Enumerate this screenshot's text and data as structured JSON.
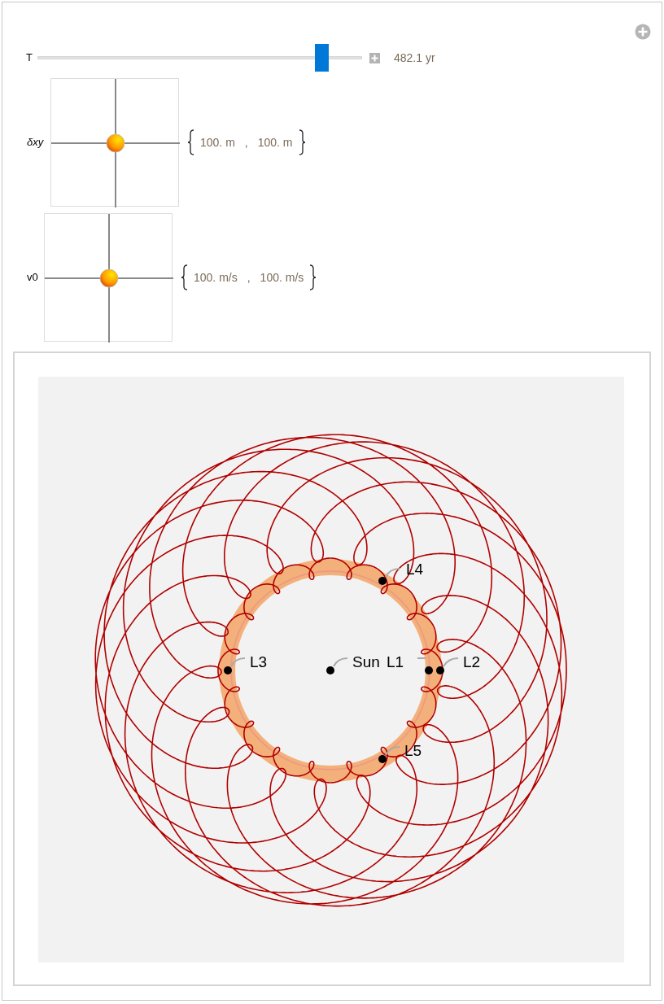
{
  "slider": {
    "label": "T",
    "level": 0.88,
    "reading": "482.1 yr"
  },
  "pads": [
    {
      "label": "δxy",
      "values": [
        "100. m",
        "100. m"
      ],
      "separator": ","
    },
    {
      "label": "v0",
      "values": [
        "100. m/s",
        "100. m/s"
      ],
      "separator": ","
    }
  ],
  "plot": {
    "points": [
      {
        "label": "L4"
      },
      {
        "label": "L3"
      },
      {
        "label": "Sun"
      },
      {
        "label": "L1"
      },
      {
        "label": "L2"
      },
      {
        "label": "L5"
      }
    ]
  }
}
